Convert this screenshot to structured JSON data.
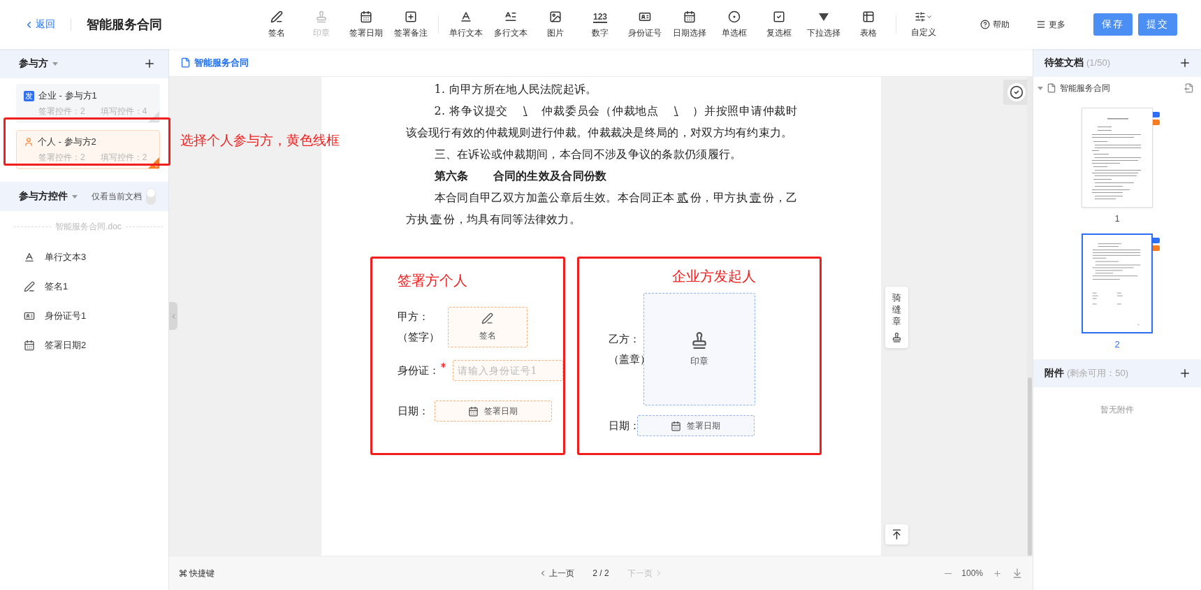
{
  "header": {
    "back": "返回",
    "title": "智能服务合同"
  },
  "tool_groups": [
    [
      {
        "kind": "signature",
        "label": "签名",
        "disabled": false
      },
      {
        "kind": "seal",
        "label": "印章",
        "disabled": true
      },
      {
        "kind": "sign-date",
        "label": "签署日期",
        "disabled": false
      },
      {
        "kind": "note",
        "label": "签署备注",
        "disabled": false
      }
    ],
    [
      {
        "kind": "single-text",
        "label": "单行文本",
        "disabled": false
      },
      {
        "kind": "multi-text",
        "label": "多行文本",
        "disabled": false
      },
      {
        "kind": "image",
        "label": "图片",
        "disabled": false
      },
      {
        "kind": "number",
        "label": "数字",
        "icon_text": "123",
        "disabled": false
      },
      {
        "kind": "id",
        "label": "身份证号",
        "disabled": false
      },
      {
        "kind": "date",
        "label": "日期选择",
        "disabled": false
      },
      {
        "kind": "radio",
        "label": "单选框",
        "disabled": false
      },
      {
        "kind": "checkbox",
        "label": "复选框",
        "disabled": false
      },
      {
        "kind": "select",
        "label": "下拉选择",
        "disabled": false
      },
      {
        "kind": "table",
        "label": "表格",
        "disabled": false
      }
    ],
    [
      {
        "kind": "custom",
        "label": "自定义",
        "disabled": false
      }
    ]
  ],
  "header_actions": [
    {
      "kind": "help",
      "label": "帮助"
    },
    {
      "kind": "more",
      "label": "更多"
    }
  ],
  "buttons": [
    {
      "label": "保存"
    },
    {
      "label": "提交"
    }
  ],
  "participants": {
    "title": "参与方",
    "items": [
      {
        "kind": "company",
        "badge": "发",
        "name": "企业 - 参与方1",
        "sign_controls": "签署控件：2",
        "fill_controls": "填写控件：4",
        "selected": false
      },
      {
        "kind": "person",
        "name": "个人 - 参与方2",
        "sign_controls": "签署控件：2",
        "fill_controls": "填写控件：2",
        "selected": true
      }
    ]
  },
  "callout": {
    "text": "选择个人参与方，黄色线框"
  },
  "controls": {
    "title": "参与方控件",
    "filter_label": "仅看当前文档",
    "filter_on": false,
    "doc_name": "智能服务合同.doc",
    "items": [
      {
        "kind": "single-text",
        "label": "单行文本3"
      },
      {
        "kind": "signature",
        "label": "签名1"
      },
      {
        "kind": "id",
        "label": "身份证号1"
      },
      {
        "kind": "date",
        "label": "签署日期2"
      }
    ]
  },
  "doc_tab": {
    "label": "智能服务合同"
  },
  "document": {
    "paragraphs": [
      {
        "kind": "body",
        "segments": [
          {
            "kind": "plain",
            "text": "1. 向甲方所在地人民法院起诉。"
          }
        ]
      },
      {
        "kind": "body",
        "segments": [
          {
            "kind": "plain",
            "text": "2. 将争议提交"
          },
          {
            "kind": "blank",
            "text": "\\"
          },
          {
            "kind": "plain",
            "text": "仲裁委员会（仲裁地点"
          },
          {
            "kind": "blank",
            "text": "\\"
          },
          {
            "kind": "plain",
            "text": "）并按照申请仲裁时该会现行有效的仲裁规则进行仲裁。仲裁裁决是终局的，对双方均有约束力。"
          }
        ]
      },
      {
        "kind": "body",
        "segments": [
          {
            "kind": "plain",
            "text": "三、在诉讼或仲裁期间，本合同不涉及争议的条款仍须履行。"
          }
        ]
      },
      {
        "kind": "heading",
        "segments": [
          {
            "kind": "plain",
            "text": "第六条"
          },
          {
            "kind": "plain",
            "text": "合同的生效及合同份数"
          }
        ]
      },
      {
        "kind": "body",
        "segments": [
          {
            "kind": "plain",
            "text": "本合同自甲乙双方加盖公章后生效。本合同正本"
          },
          {
            "kind": "underline",
            "text": "贰"
          },
          {
            "kind": "plain",
            "text": "份，甲方执"
          },
          {
            "kind": "underline",
            "text": "壹"
          },
          {
            "kind": "plain",
            "text": "份，乙方执"
          },
          {
            "kind": "underline",
            "text": "壹"
          },
          {
            "kind": "plain",
            "text": "份，均具有同等法律效力。"
          }
        ]
      }
    ],
    "signature_blocks": [
      {
        "kind": "person",
        "annotation": "签署方个人",
        "rows": [
          {
            "kind": "signature",
            "label": "甲方：",
            "sub_label": "（签字）",
            "field": "签名"
          },
          {
            "kind": "input",
            "label": "身份证：",
            "required": true,
            "placeholder": "请输入身份证号1"
          },
          {
            "kind": "date",
            "label": "日期：",
            "field": "签署日期"
          }
        ]
      },
      {
        "kind": "company",
        "annotation": "企业方发起人",
        "rows": [
          {
            "kind": "seal",
            "label": "乙方：",
            "sub_label": "（盖章）",
            "field": "印章"
          },
          {
            "kind": "date",
            "label": "日期：",
            "field": "签署日期"
          }
        ]
      }
    ]
  },
  "seam_seal": {
    "label": "骑缝章"
  },
  "pending_docs": {
    "title": "待签文档",
    "count": "(1/50)",
    "document": {
      "name": "智能服务合同",
      "expanded": true
    },
    "pages": [
      {
        "number": "1",
        "selected": false,
        "markers": [
          {
            "color": "#2f6ff5"
          },
          {
            "color": "#f97c22"
          }
        ]
      },
      {
        "number": "2",
        "selected": true,
        "markers": [
          {
            "color": "#2f6ff5"
          },
          {
            "color": "#f97c22"
          }
        ]
      }
    ]
  },
  "attachments": {
    "title": "附件",
    "quota": "(剩余可用：50)",
    "empty_text": "暂无附件"
  },
  "footer": {
    "shortcuts": "快捷键",
    "prev": "上一页",
    "prev_disabled": false,
    "page": "2 / 2",
    "next": "下一页",
    "next_disabled": true,
    "zoom": "100%"
  }
}
